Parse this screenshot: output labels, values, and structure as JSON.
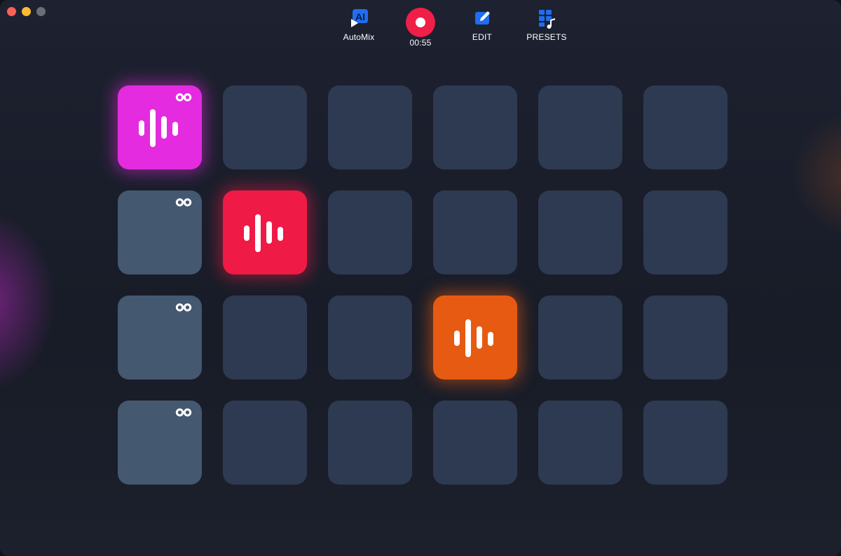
{
  "window": {
    "traffic_lights": [
      {
        "name": "close",
        "color": "#fe5f57"
      },
      {
        "name": "minimize",
        "color": "#febc2e"
      },
      {
        "name": "zoom",
        "color": "#6b6e75"
      }
    ]
  },
  "toolbar": {
    "automix_label": "AutoMix",
    "automix_icon_text": "AI",
    "record_time": "00:55",
    "edit_label": "EDIT",
    "presets_label": "PRESETS"
  },
  "colors": {
    "magenta": "#e42bdf",
    "red": "#ef1a45",
    "orange": "#e75a12",
    "pad_empty": "#2e3a51",
    "pad_loop": "#445870",
    "record": "#ef1f48"
  },
  "pads": {
    "rows": [
      [
        {
          "state": "active",
          "color": "magenta",
          "loop": true
        },
        {
          "state": "empty"
        },
        {
          "state": "empty"
        },
        {
          "state": "empty"
        },
        {
          "state": "empty"
        },
        {
          "state": "empty"
        }
      ],
      [
        {
          "state": "loaded",
          "loop": true
        },
        {
          "state": "active",
          "color": "red",
          "loop": false
        },
        {
          "state": "empty"
        },
        {
          "state": "empty"
        },
        {
          "state": "empty"
        },
        {
          "state": "empty"
        }
      ],
      [
        {
          "state": "loaded",
          "loop": true
        },
        {
          "state": "empty"
        },
        {
          "state": "empty"
        },
        {
          "state": "active",
          "color": "orange",
          "loop": false
        },
        {
          "state": "empty"
        },
        {
          "state": "empty"
        }
      ],
      [
        {
          "state": "loaded",
          "loop": true
        },
        {
          "state": "empty"
        },
        {
          "state": "empty"
        },
        {
          "state": "empty"
        },
        {
          "state": "empty"
        },
        {
          "state": "empty"
        }
      ]
    ],
    "icons": {
      "waveform": "waveform-icon",
      "loop": "infinity-loop-icon"
    }
  }
}
